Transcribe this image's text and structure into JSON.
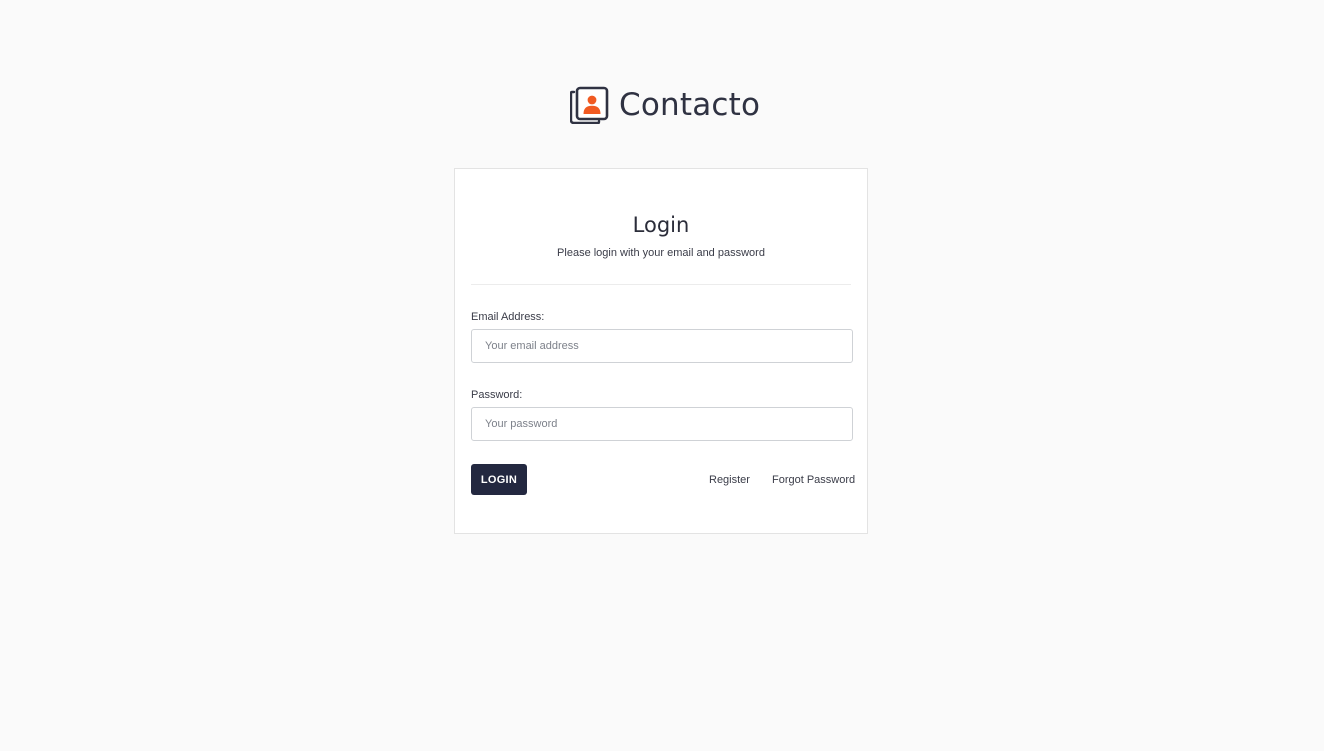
{
  "brand": {
    "name": "Contacto",
    "icon": "contact-book-icon",
    "colors": {
      "text": "#2f3242",
      "accent": "#f05a22"
    }
  },
  "login_card": {
    "title": "Login",
    "subtitle": "Please login with your email and password",
    "email": {
      "label": "Email Address:",
      "placeholder": "Your email address",
      "value": ""
    },
    "password": {
      "label": "Password:",
      "placeholder": "Your password",
      "value": ""
    },
    "submit_label": "LOGIN",
    "links": {
      "register": "Register",
      "forgot_password": "Forgot Password"
    }
  },
  "colors": {
    "background": "#fafafa",
    "card": "#ffffff",
    "primary_button": "#232840"
  }
}
